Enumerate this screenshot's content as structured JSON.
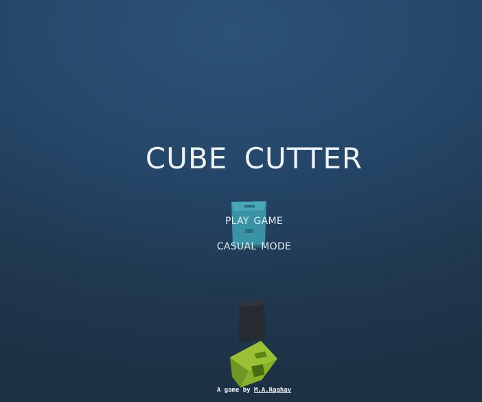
{
  "game": {
    "title": "CUBE CUTTER"
  },
  "menu": {
    "play_label": "PLAY GAME",
    "casual_label": "CASUAL MODE"
  },
  "credit": {
    "prefix": "A game by ",
    "author": "M.A.Raghav"
  },
  "colors": {
    "background_top": "#2c5276",
    "background_bottom": "#1d3144",
    "title_text": "#eef3f7",
    "teal_cube": "#3a94a6",
    "dark_cube": "#272c33",
    "green_cube": "#8cb52a"
  },
  "scene_objects": [
    "teal-cube",
    "dark-cube",
    "green-cube"
  ]
}
